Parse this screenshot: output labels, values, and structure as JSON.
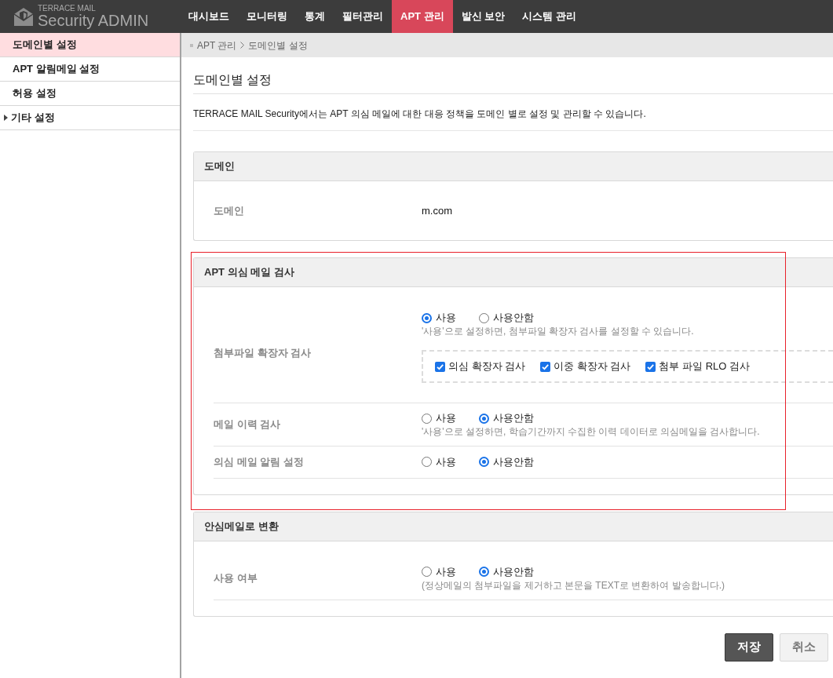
{
  "header": {
    "logo_small": "TERRACE MAIL",
    "logo_large": "Security ADMIN",
    "nav": [
      {
        "label": "대시보드",
        "selected": false
      },
      {
        "label": "모니터링",
        "selected": false
      },
      {
        "label": "통계",
        "selected": false
      },
      {
        "label": "필터관리",
        "selected": false
      },
      {
        "label": "APT 관리",
        "selected": true
      },
      {
        "label": "발신 보안",
        "selected": false
      },
      {
        "label": "시스템 관리",
        "selected": false
      }
    ]
  },
  "sidebar": {
    "items": [
      {
        "label": "도메인별 설정",
        "selected": true,
        "expandable": false
      },
      {
        "label": "APT 알림메일 설정",
        "selected": false,
        "expandable": false
      },
      {
        "label": "허용 설정",
        "selected": false,
        "expandable": false
      },
      {
        "label": "기타 설정",
        "selected": false,
        "expandable": true
      }
    ]
  },
  "breadcrumb": [
    "APT 관리",
    "도메인별 설정"
  ],
  "page": {
    "title": "도메인별 설정",
    "description": "TERRACE MAIL Security에서는 APT 의심 메일에 대한 대응 정책을 도메인 별로 설정 및 관리할 수 있습니다."
  },
  "sections": [
    {
      "title": "도메인",
      "highlighted": false,
      "rows": [
        {
          "kind": "text",
          "label": "도메인",
          "value": "m.com"
        }
      ]
    },
    {
      "title": "APT 의심 메일 검사",
      "highlighted": true,
      "rows": [
        {
          "kind": "radio",
          "label": "첨부파일 확장자 검사",
          "options": [
            {
              "label": "사용",
              "selected": true
            },
            {
              "label": "사용안함",
              "selected": false
            }
          ],
          "hint": "'사용'으로 설정하면, 첨부파일 확장자 검사를 설정할 수 있습니다.",
          "checkboxes": [
            {
              "label": "의심 확장자 검사",
              "checked": true
            },
            {
              "label": "이중 확장자 검사",
              "checked": true
            },
            {
              "label": "첨부 파일 RLO 검사",
              "checked": true
            }
          ]
        },
        {
          "kind": "radio",
          "label": "메일 이력 검사",
          "options": [
            {
              "label": "사용",
              "selected": false
            },
            {
              "label": "사용안함",
              "selected": true
            }
          ],
          "hint": "'사용'으로 설정하면, 학습기간까지 수집한 이력 데이터로 의심메일을 검사합니다."
        },
        {
          "kind": "radio",
          "label": "의심 메일 알림 설정",
          "options": [
            {
              "label": "사용",
              "selected": false
            },
            {
              "label": "사용안함",
              "selected": true
            }
          ]
        }
      ]
    },
    {
      "title": "안심메일로 변환",
      "highlighted": false,
      "rows": [
        {
          "kind": "radio",
          "label": "사용 여부",
          "options": [
            {
              "label": "사용",
              "selected": false
            },
            {
              "label": "사용안함",
              "selected": true
            }
          ],
          "hint": "(정상메일의 첨부파일을 제거하고 본문을 TEXT로 변환하여 발송합니다.)"
        }
      ]
    }
  ],
  "buttons": [
    {
      "label": "저장",
      "kind": "primary"
    },
    {
      "label": "취소",
      "kind": "secondary"
    }
  ]
}
